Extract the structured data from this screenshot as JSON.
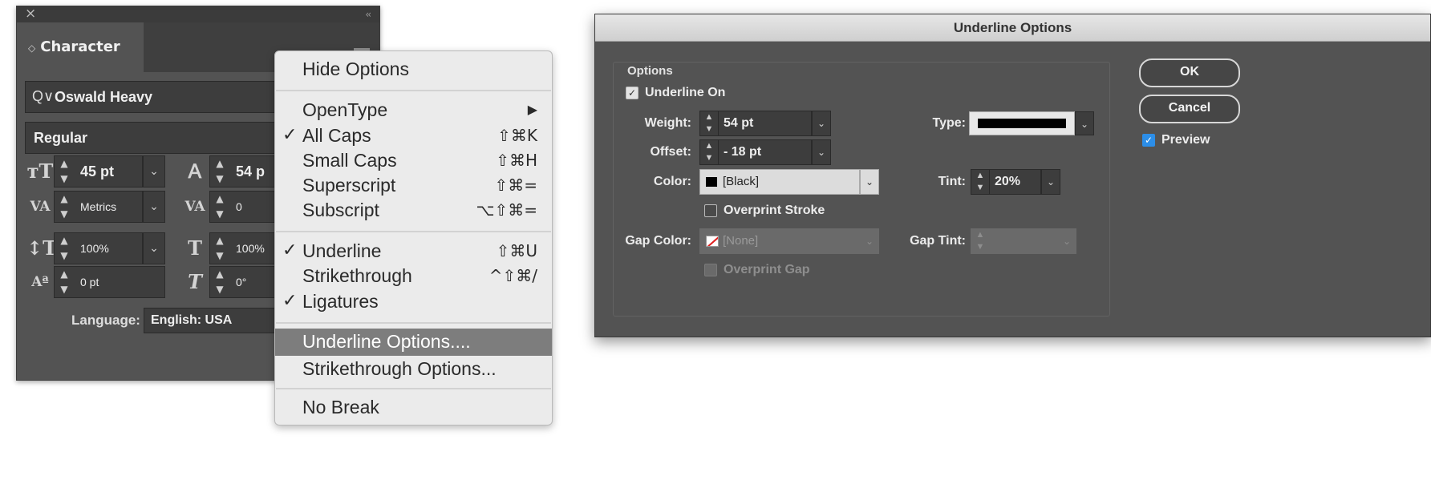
{
  "character_panel": {
    "close_glyph": "×",
    "collapse_glyph": "‹‹",
    "tab_arrows": "◇",
    "tab_label": "Character",
    "search_glyph": "Q∨",
    "font_family": "Oswald Heavy",
    "font_style": "Regular",
    "font_size": "45 pt",
    "leading": "54 p",
    "kerning": "Metrics",
    "tracking": "0",
    "vertical_scale": "100%",
    "horizontal_scale": "100%",
    "baseline_shift": "0 pt",
    "skew": "0°",
    "language_label": "Language:",
    "language_value": "English: USA"
  },
  "menu": {
    "items": [
      {
        "label": "Hide Options",
        "check": "",
        "shortcut": ""
      },
      {
        "label": "OpenType",
        "check": "",
        "shortcut": "▶"
      },
      {
        "label": "All Caps",
        "check": "✓",
        "shortcut": "⇧⌘K"
      },
      {
        "label": "Small Caps",
        "check": "",
        "shortcut": "⇧⌘H"
      },
      {
        "label": "Superscript",
        "check": "",
        "shortcut": "⇧⌘="
      },
      {
        "label": "Subscript",
        "check": "",
        "shortcut": "⌥⇧⌘="
      },
      {
        "label": "Underline",
        "check": "✓",
        "shortcut": "⇧⌘U"
      },
      {
        "label": "Strikethrough",
        "check": "",
        "shortcut": "^⇧⌘/"
      },
      {
        "label": "Ligatures",
        "check": "✓",
        "shortcut": ""
      },
      {
        "label": "Underline Options....",
        "check": "",
        "shortcut": "",
        "highlighted": true
      },
      {
        "label": "Strikethrough Options...",
        "check": "",
        "shortcut": ""
      },
      {
        "label": "No Break",
        "check": "",
        "shortcut": ""
      }
    ]
  },
  "dialog": {
    "title": "Underline Options",
    "group_label": "Options",
    "underline_on_label": "Underline On",
    "underline_on_checked": true,
    "weight_label": "Weight:",
    "weight_value": "54 pt",
    "offset_label": "Offset:",
    "offset_value": "- 18 pt",
    "type_label": "Type:",
    "color_label": "Color:",
    "color_value": "[Black]",
    "tint_label": "Tint:",
    "tint_value": "20%",
    "overprint_stroke_label": "Overprint Stroke",
    "gap_color_label": "Gap Color:",
    "gap_color_value": "[None]",
    "gap_tint_label": "Gap Tint:",
    "overprint_gap_label": "Overprint Gap",
    "ok_label": "OK",
    "cancel_label": "Cancel",
    "preview_label": "Preview",
    "preview_checked": true,
    "accent_color": "#2c8ee8"
  }
}
